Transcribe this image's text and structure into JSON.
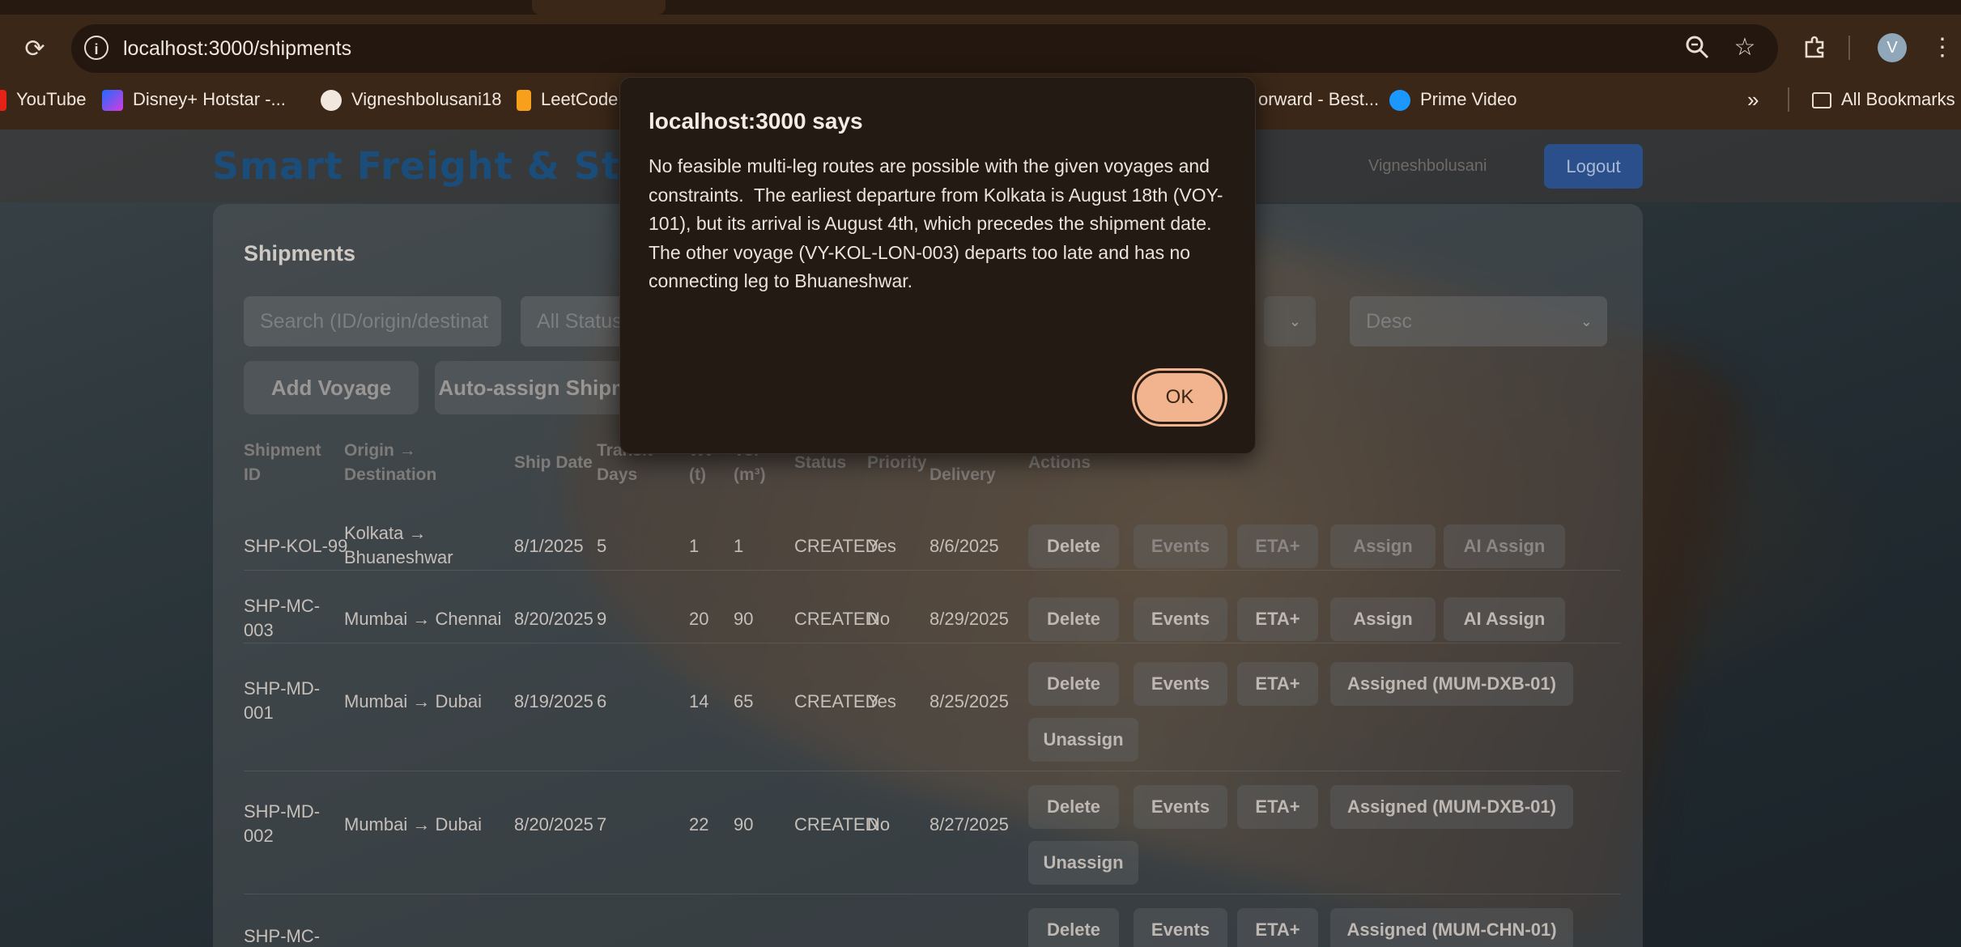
{
  "browser": {
    "url": "localhost:3000/shipments",
    "avatar_letter": "V",
    "bookmarks": [
      {
        "label": "YouTube",
        "icon": "youtube-icon",
        "color": "#e62117"
      },
      {
        "label": "Disney+ Hotstar -...",
        "icon": "hotstar-icon",
        "color": "#7b3fe4"
      },
      {
        "label": "Vigneshbolusani18",
        "icon": "github-icon",
        "color": "#ffffff"
      },
      {
        "label": "LeetCode",
        "icon": "leetcode-icon",
        "color": "#f89f1b"
      },
      {
        "label": "orward - Best...",
        "icon": "bookmark-icon",
        "color": "#999999"
      },
      {
        "label": "Prime Video",
        "icon": "prime-video-icon",
        "color": "#1a98ff"
      }
    ],
    "overflow_label": "»",
    "all_bookmarks_label": "All Bookmarks"
  },
  "app": {
    "brand": "Smart Freight & Stor",
    "user_name": "Vigneshbolusani",
    "logout_label": "Logout",
    "title": "Shipments",
    "filters": {
      "search_placeholder": "Search (ID/origin/destinat",
      "status_value": "All Status",
      "sort_order": "Desc"
    },
    "actions": {
      "add_voyage": "Add Voyage",
      "auto_assign": "Auto-assign Shipme"
    },
    "columns": [
      "Shipment ID",
      "Origin → Destination",
      "Ship Date",
      "Transit Days",
      "Wt (t)",
      "Vol (m³)",
      "Status",
      "Priority",
      "Delivery",
      "Actions"
    ],
    "rows": [
      {
        "id": "SHP-KOL-99",
        "route": "Kolkata → Bhuaneshwar",
        "ship_date": "8/1/2025",
        "transit": "5",
        "wt": "1",
        "vol": "1",
        "status": "CREATED",
        "priority": "Yes",
        "delivery": "8/6/2025",
        "assign": "Assign",
        "ai": "AI Assign"
      },
      {
        "id": "SHP-MC-003",
        "route": "Mumbai → Chennai",
        "ship_date": "8/20/2025",
        "transit": "9",
        "wt": "20",
        "vol": "90",
        "status": "CREATED",
        "priority": "No",
        "delivery": "8/29/2025",
        "assign": "Assign",
        "ai": "AI Assign"
      },
      {
        "id": "SHP-MD-001",
        "route": "Mumbai → Dubai",
        "ship_date": "8/19/2025",
        "transit": "6",
        "wt": "14",
        "vol": "65",
        "status": "CREATED",
        "priority": "Yes",
        "delivery": "8/25/2025",
        "assign": "Assigned (MUM-DXB-01)",
        "unassign": "Unassign"
      },
      {
        "id": "SHP-MD-002",
        "route": "Mumbai → Dubai",
        "ship_date": "8/20/2025",
        "transit": "7",
        "wt": "22",
        "vol": "90",
        "status": "CREATED",
        "priority": "No",
        "delivery": "8/27/2025",
        "assign": "Assigned (MUM-DXB-01)",
        "unassign": "Unassign"
      },
      {
        "id": "SHP-MC-",
        "assign": "Assigned (MUM-CHN-01)"
      }
    ],
    "btn": {
      "delete": "Delete",
      "events": "Events",
      "eta": "ETA+"
    }
  },
  "dialog": {
    "title": "localhost:3000 says",
    "message": "No feasible multi-leg routes are possible with the given voyages and constraints.  The earliest departure from Kolkata is August 18th (VOY-101), but its arrival is August 4th, which precedes the shipment date.  The other voyage (VY-KOL-LON-003) departs too late and has no connecting leg to Bhuaneshwar.",
    "ok_label": "OK"
  }
}
